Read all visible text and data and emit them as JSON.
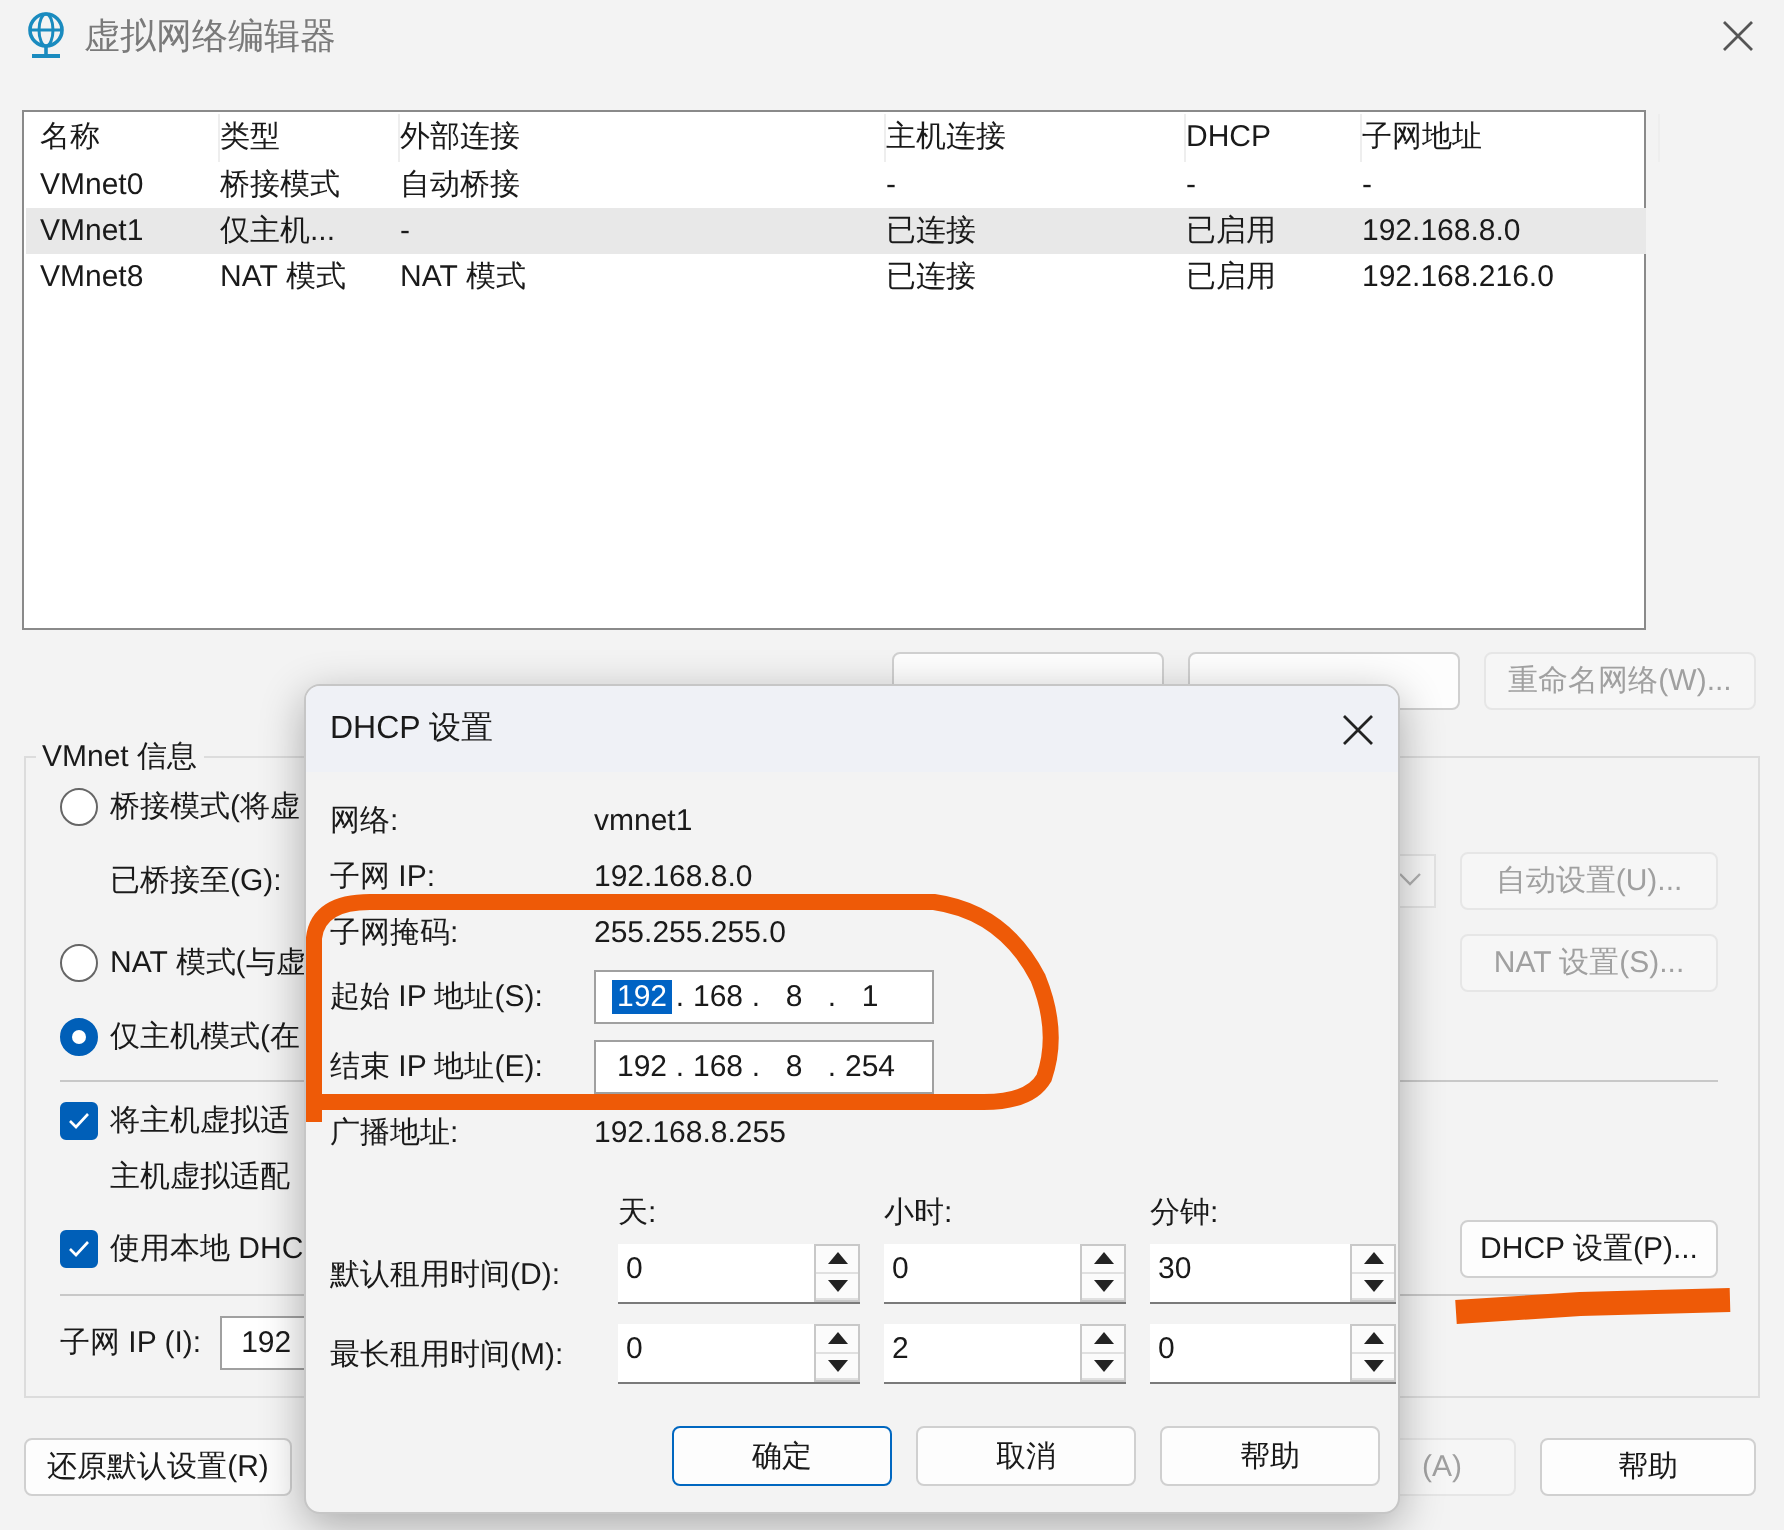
{
  "window": {
    "title": "虚拟网络编辑器"
  },
  "network_table": {
    "columns": [
      "名称",
      "类型",
      "外部连接",
      "主机连接",
      "DHCP",
      "子网地址"
    ],
    "rows": [
      {
        "cells": [
          "VMnet0",
          "桥接模式",
          "自动桥接",
          "-",
          "-",
          "-"
        ],
        "selected": false
      },
      {
        "cells": [
          "VMnet1",
          "仅主机...",
          "-",
          "已连接",
          "已启用",
          "192.168.8.0"
        ],
        "selected": true
      },
      {
        "cells": [
          "VMnet8",
          "NAT 模式",
          "NAT 模式",
          "已连接",
          "已启用",
          "192.168.216.0"
        ],
        "selected": false
      }
    ]
  },
  "table_buttons": [
    {
      "disabled": false
    },
    {
      "disabled": false
    },
    {
      "label": "重命名网络(W)...",
      "disabled": true
    }
  ],
  "vmnet_info": {
    "title": "VMnet 信息",
    "modes": [
      {
        "label": "桥接模式(将虚",
        "selected": false
      },
      {
        "label": "NAT 模式(与虚",
        "selected": false
      },
      {
        "label": "仅主机模式(在",
        "selected": true
      }
    ],
    "bridged_to_label": "已桥接至(G):",
    "auto_settings_button": {
      "label": "自动设置(U)...",
      "disabled": true
    },
    "nat_settings_button": {
      "label": "NAT 设置(S)...",
      "disabled": true
    },
    "options": [
      {
        "label": "将主机虚拟适",
        "checked": true
      },
      {
        "label": "使用本地 DHC",
        "checked": true
      }
    ],
    "adapter_note": "主机虚拟适配",
    "dhcp_settings_button": {
      "label": "DHCP 设置(P)...",
      "disabled": false
    },
    "subnet_ip_label": "子网 IP (I):",
    "subnet_ip_value": "192"
  },
  "bottom_buttons": [
    {
      "label": "还原默认设置(R)",
      "disabled": false
    },
    {
      "label": "(A)",
      "disabled": true
    },
    {
      "label": "帮助",
      "disabled": false
    }
  ],
  "dhcp_dialog": {
    "title": "DHCP 设置",
    "info": [
      {
        "label": "网络:",
        "value": "vmnet1"
      },
      {
        "label": "子网 IP:",
        "value": "192.168.8.0"
      },
      {
        "label": "子网掩码:",
        "value": "255.255.255.0"
      }
    ],
    "ip_fields": [
      {
        "label": "起始 IP 地址(S):",
        "separator": ".",
        "octets": [
          {
            "text": "192",
            "selected": true
          },
          {
            "text": "168",
            "selected": false
          },
          {
            "text": "8",
            "selected": false
          },
          {
            "text": "1",
            "selected": false
          }
        ]
      },
      {
        "label": "结束 IP 地址(E):",
        "separator": ".",
        "octets": [
          {
            "text": "192",
            "selected": false
          },
          {
            "text": "168",
            "selected": false
          },
          {
            "text": "8",
            "selected": false
          },
          {
            "text": "254",
            "selected": false
          }
        ]
      }
    ],
    "broadcast": {
      "label": "广播地址:",
      "value": "192.168.8.255"
    },
    "lease_headers": [
      "天:",
      "小时:",
      "分钟:"
    ],
    "leases": [
      {
        "label": "默认租用时间(D):",
        "values": [
          "0",
          "0",
          "30"
        ]
      },
      {
        "label": "最长租用时间(M):",
        "values": [
          "0",
          "2",
          "0"
        ]
      }
    ],
    "buttons": [
      {
        "label": "确定",
        "default": true
      },
      {
        "label": "取消",
        "default": false
      },
      {
        "label": "帮助",
        "default": false
      }
    ]
  },
  "annotations": [
    {
      "kind": "loop"
    },
    {
      "kind": "underline"
    }
  ]
}
